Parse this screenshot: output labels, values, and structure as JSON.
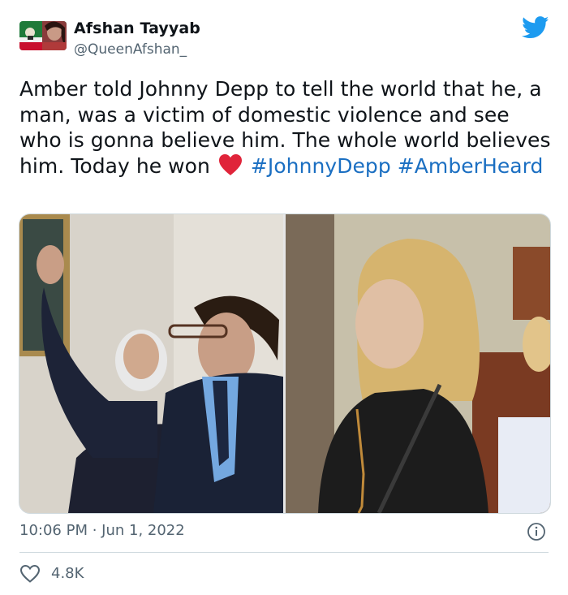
{
  "user": {
    "display_name": "Afshan Tayyab",
    "handle": "@QueenAfshan_"
  },
  "tweet": {
    "text_part1": "Amber told Johnny Depp to tell the world that he, a man, was a victim of domestic violence and see who is gonna believe him. The whole world believes him. Today he won",
    "hashtags": [
      "#JohnnyDepp",
      "#AmberHeard"
    ]
  },
  "meta": {
    "time": "10:06 PM",
    "separator": "·",
    "date": "Jun 1, 2022",
    "timestamp_text": "10:06 PM · Jun 1, 2022"
  },
  "stats": {
    "likes": "4.8K"
  },
  "icons": {
    "platform": "twitter-bird-icon",
    "reaction_emoji": "red-heart-emoji",
    "info": "info-icon",
    "like": "heart-outline-icon"
  },
  "colors": {
    "brand_blue": "#1d9bf0",
    "hashtag": "#1b6fc2",
    "secondary_text": "#536471",
    "heart_emoji": "#e0243a"
  }
}
